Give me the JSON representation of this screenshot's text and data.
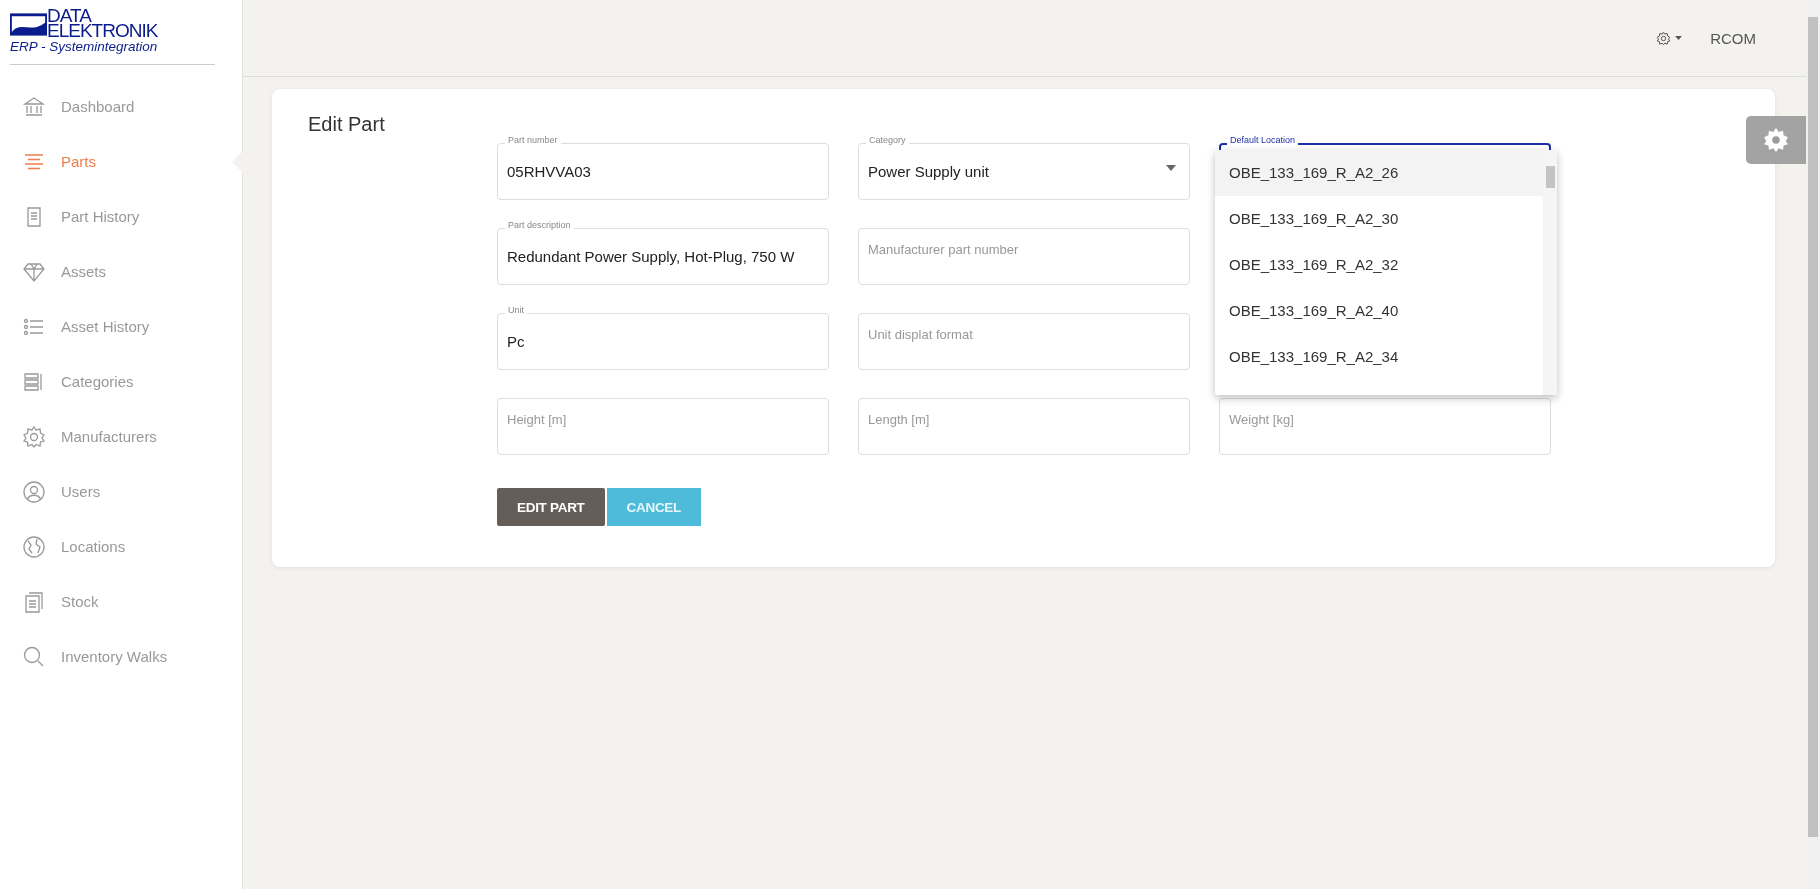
{
  "logo": {
    "line_1": "DATA",
    "line_2": "ELEKTRONIK",
    "tagline": "ERP - Systemintegration"
  },
  "sidebar": {
    "items": [
      {
        "label": "Dashboard",
        "selected": false
      },
      {
        "label": "Parts",
        "selected": true
      },
      {
        "label": "Part History",
        "selected": false
      },
      {
        "label": "Assets",
        "selected": false
      },
      {
        "label": "Asset History",
        "selected": false
      },
      {
        "label": "Categories",
        "selected": false
      },
      {
        "label": "Manufacturers",
        "selected": false
      },
      {
        "label": "Users",
        "selected": false
      },
      {
        "label": "Locations",
        "selected": false
      },
      {
        "label": "Stock",
        "selected": false
      },
      {
        "label": "Inventory Walks",
        "selected": false
      }
    ]
  },
  "top_bar": {
    "user": "RCOM"
  },
  "form": {
    "title": "Edit Part",
    "columns": [
      [
        {
          "kind": "text",
          "label": "Part number",
          "value": "05RHVVA03"
        },
        {
          "kind": "text",
          "label": "Part description",
          "value": "Redundant Power Supply, Hot-Plug, 750 W"
        },
        {
          "kind": "text",
          "label": "Unit",
          "value": "Pc"
        },
        {
          "kind": "text",
          "placeholder": "Height [m]"
        }
      ],
      [
        {
          "kind": "select",
          "label": "Category",
          "value": "Power Supply unit"
        },
        {
          "kind": "text",
          "placeholder": "Manufacturer part number"
        },
        {
          "kind": "text",
          "placeholder": "Unit displat format"
        },
        {
          "kind": "text",
          "placeholder": "Length [m]"
        }
      ],
      [
        {
          "kind": "select",
          "label": "Default Location",
          "focused": true,
          "options": [
            {
              "label": "OBE_133_169_R_A2_26",
              "selected": true
            },
            {
              "label": "OBE_133_169_R_A2_30",
              "selected": false
            },
            {
              "label": "OBE_133_169_R_A2_32",
              "selected": false
            },
            {
              "label": "OBE_133_169_R_A2_40",
              "selected": false
            },
            {
              "label": "OBE_133_169_R_A2_34",
              "selected": false
            }
          ]
        },
        {
          "kind": "text",
          "placeholder": "Weight [kg]"
        }
      ]
    ],
    "buttons": [
      {
        "kind": "primary",
        "label": "EDIT PART"
      },
      {
        "kind": "secondary",
        "label": "CANCEL"
      }
    ]
  }
}
